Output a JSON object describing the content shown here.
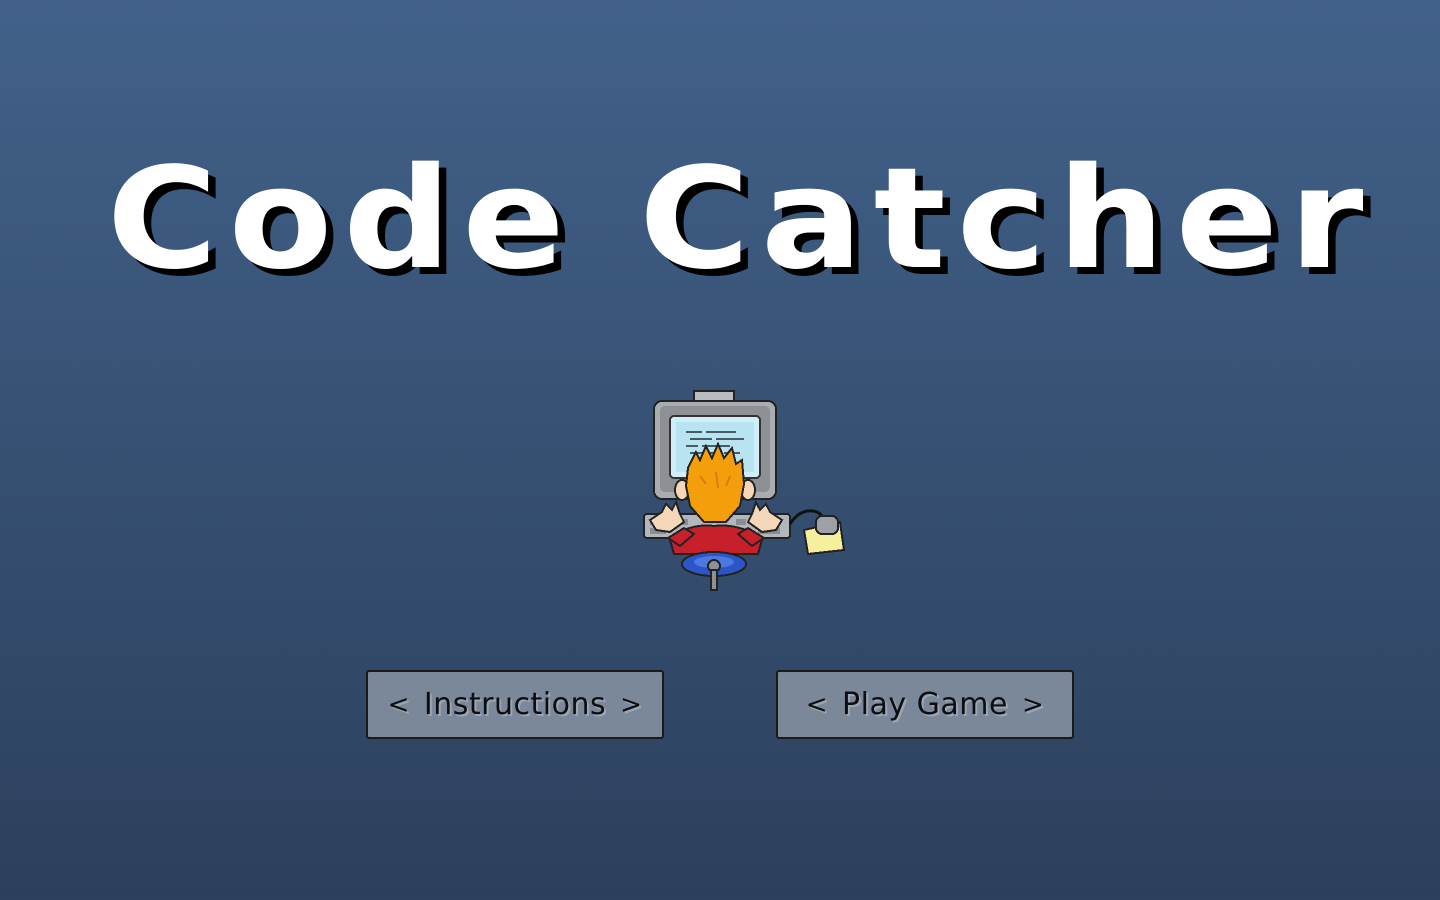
{
  "game": {
    "title": "Code Catcher"
  },
  "menu": {
    "instructions_label": "Instructions",
    "play_label": "Play Game",
    "left_chevron": "<",
    "right_chevron": ">"
  },
  "icons": {
    "hero": "programmer-at-computer-icon"
  },
  "colors": {
    "background_top": "#42618a",
    "background_bottom": "#2c405c",
    "button_fill": "#7a8899",
    "title_text": "#ffffff"
  }
}
